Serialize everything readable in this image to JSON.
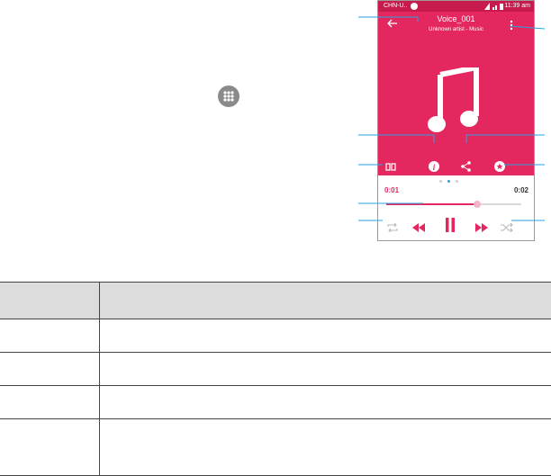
{
  "status_bar": {
    "carrier": "CHN-U..",
    "time": "11:39 am"
  },
  "player": {
    "title": "Voice_001",
    "subtitle": "Unknown artist - Music",
    "elapsed": "0:01",
    "total": "0:02",
    "progress": 0.67,
    "page_dots": 3,
    "active_dot": 1
  },
  "icons": {
    "apps": "apps-drawer-icon",
    "back": "back-arrow-icon",
    "more": "more-vert-icon",
    "note": "music-note-icon",
    "lyrics": "book-icon",
    "info": "info-icon",
    "share": "share-icon",
    "favorite": "favorite-icon",
    "repeat": "repeat-icon",
    "rewind": "rewind-icon",
    "pause": "pause-icon",
    "forward": "fast-forward-icon",
    "shuffle": "shuffle-icon"
  },
  "colors": {
    "accent": "#e5275f",
    "status_bar": "#c71a4d",
    "callout": "#2aa3e0",
    "table_header": "#dcdcdc"
  },
  "table": {
    "headers": [
      "",
      ""
    ],
    "rows": [
      [
        "",
        ""
      ],
      [
        "",
        ""
      ],
      [
        "",
        ""
      ],
      [
        "",
        ""
      ]
    ]
  }
}
